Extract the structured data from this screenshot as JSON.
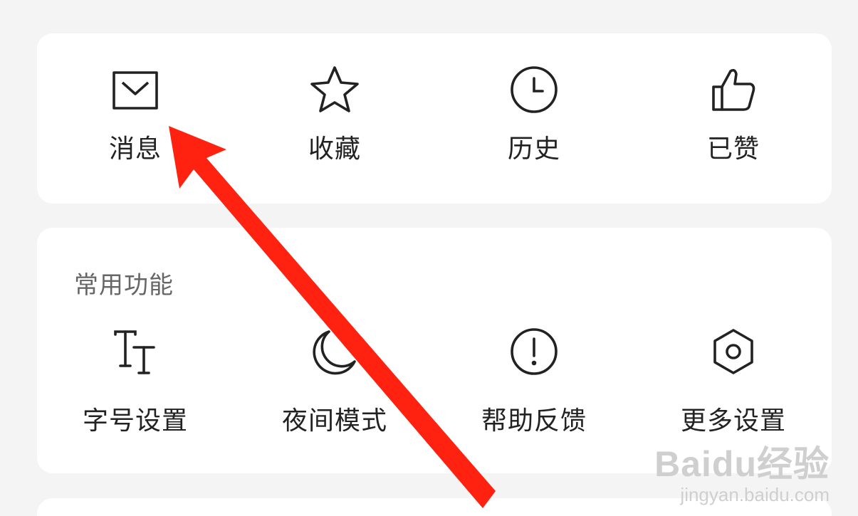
{
  "quick_actions": [
    {
      "label": "消息",
      "icon": "envelope-icon"
    },
    {
      "label": "收藏",
      "icon": "star-icon"
    },
    {
      "label": "历史",
      "icon": "clock-icon"
    },
    {
      "label": "已赞",
      "icon": "thumbs-up-icon"
    }
  ],
  "common_functions": {
    "title": "常用功能",
    "items": [
      {
        "label": "字号设置",
        "icon": "font-size-icon"
      },
      {
        "label": "夜间模式",
        "icon": "moon-icon"
      },
      {
        "label": "帮助反馈",
        "icon": "exclamation-circle-icon"
      },
      {
        "label": "更多设置",
        "icon": "hexagon-settings-icon"
      }
    ]
  },
  "watermark": {
    "brand": "Baidu经验",
    "url": "jingyan.baidu.com"
  },
  "colors": {
    "background": "#f4f4f4",
    "card": "#ffffff",
    "icon_stroke": "#222222",
    "annotation_arrow": "#ff2211"
  }
}
